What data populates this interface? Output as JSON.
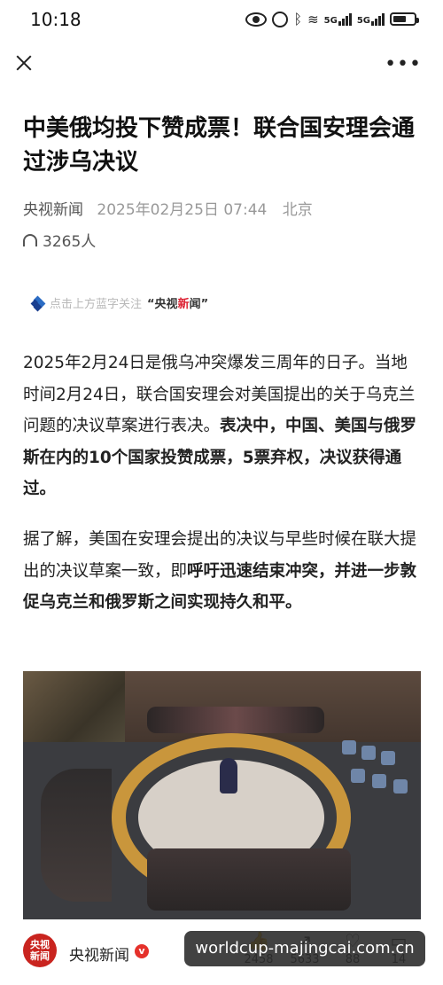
{
  "status_bar": {
    "time": "10:18",
    "network_1": "5G",
    "network_2": "5G",
    "battery_level": 0.55
  },
  "nav": {
    "close_icon": "close-icon",
    "more_label": "•••"
  },
  "article": {
    "title": "中美俄均投下赞成票！联合国安理会通过涉乌决议",
    "source": "央视新闻",
    "date": "2025年02月25日 07:44",
    "location": "北京",
    "listeners": "3265人",
    "follow_prefix": "点击上方蓝字关注",
    "follow_brand_a": "“央视",
    "follow_brand_b": "新",
    "follow_brand_c": "闻”",
    "p1_text": "2025年2月24日是俄乌冲突爆发三周年的日子。当地时间2月24日，联合国安理会对美国提出的关于乌克兰问题的决议草案进行表决。",
    "p1_bold": "表决中，中国、美国与俄罗斯在内的10个国家投赞成票，5票弃权，决议获得通过。",
    "p2_text": "据了解，美国在安理会提出的决议与早些时候在联大提出的决议草案一致，即",
    "p2_bold": "呼吁迅速结束冲突，并进一步敦促乌克兰和俄罗斯之间实现持久和平。"
  },
  "bottom_bar": {
    "avatar_text": "央视\n新闻",
    "account_name": "央视新闻",
    "verified_mark": "v",
    "like_count": "2458",
    "share_count": "5633",
    "fav_count": "88",
    "comment_count": "14"
  },
  "watermark": "worldcup-majingcai.com.cn",
  "colors": {
    "accent_red": "#d23b3b",
    "title": "#111111",
    "meta": "#999999",
    "table_gold": "#c9963c"
  }
}
